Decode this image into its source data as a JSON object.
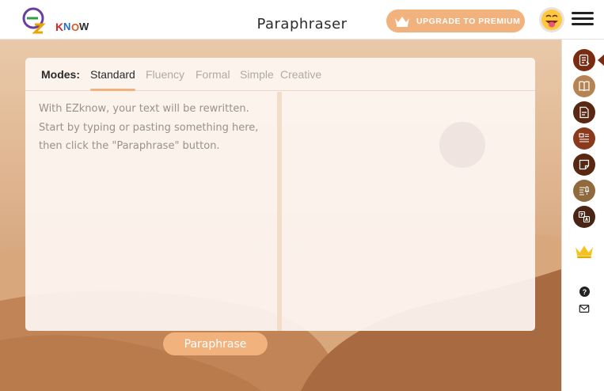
{
  "header": {
    "logo_text": "EZKNOW",
    "title": "Paraphraser",
    "upgrade_label": "UPGRADE TO PREMIUM",
    "avatar_icon": "smiley-tongue-icon",
    "menu_icon": "hamburger-menu-icon"
  },
  "editor": {
    "modes_label": "Modes:",
    "modes": [
      "Standard",
      "Fluency",
      "Formal",
      "Simple",
      "Creative"
    ],
    "active_mode": "Standard",
    "placeholder": "With EZknow, your text will be rewritten. Start by typing or pasting something here, then click the \"Paraphrase\" button.",
    "button_label": "Paraphrase"
  },
  "rail": {
    "items": [
      {
        "icon": "paraphrase-doc-icon",
        "color": "#7a2b12",
        "active": true
      },
      {
        "icon": "book-icon",
        "color": "#b68354",
        "active": false
      },
      {
        "icon": "summary-doc-icon",
        "color": "#5a2812",
        "active": false
      },
      {
        "icon": "list-doc-icon",
        "color": "#8a3a1c",
        "active": false
      },
      {
        "icon": "sticky-note-icon",
        "color": "#5a2812",
        "active": false
      },
      {
        "icon": "audio-list-icon",
        "color": "#8f6a3c",
        "active": false
      },
      {
        "icon": "translate-icon",
        "color": "#4a2515",
        "active": false
      }
    ],
    "premium_icon": "crown-icon",
    "help_icon": "question-icon",
    "mail_icon": "mail-icon"
  },
  "colors": {
    "accent": "#f1b27d",
    "brand_dark": "#7a2b12"
  }
}
